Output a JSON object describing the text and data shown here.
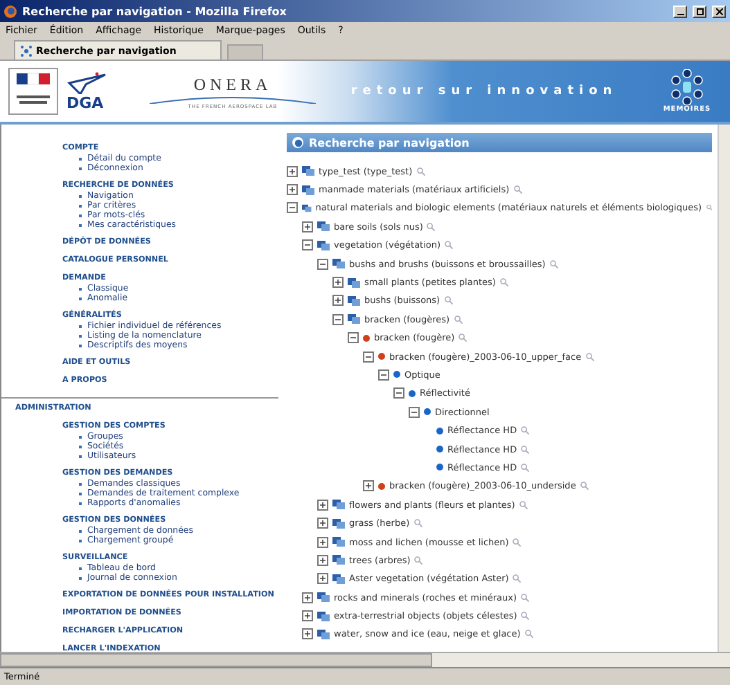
{
  "window": {
    "title": "Recherche par navigation - Mozilla Firefox"
  },
  "menu": [
    "Fichier",
    "Édition",
    "Affichage",
    "Historique",
    "Marque-pages",
    "Outils",
    "?"
  ],
  "tabs": [
    {
      "label": "Recherche par navigation",
      "selected": true
    },
    {
      "selected": false
    }
  ],
  "banner": {
    "dga": "DGA",
    "onera": "ONERA",
    "onera_tagline": "THE FRENCH AEROSPACE LAB",
    "slogan": "retour sur innovation",
    "memoires": "MEMOIRES"
  },
  "sidebar": {
    "sections": [
      {
        "title": "COMPTE",
        "items": [
          "Détail du compte",
          "Déconnexion"
        ]
      },
      {
        "title": "RECHERCHE DE DONNÉES",
        "items": [
          "Navigation",
          "Par critères",
          "Par mots-clés",
          "Mes caractéristiques"
        ]
      },
      {
        "title": "DÉPÔT DE DONNÉES"
      },
      {
        "title": "CATALOGUE PERSONNEL"
      },
      {
        "title": "DEMANDE",
        "items": [
          "Classique",
          "Anomalie"
        ]
      },
      {
        "title": "GÉNÉRALITÉS",
        "items": [
          "Fichier individuel de références",
          "Listing de la nomenclature",
          "Descriptifs des moyens"
        ]
      },
      {
        "title": "AIDE ET OUTILS"
      },
      {
        "title": "A PROPOS"
      }
    ],
    "admin": {
      "title": "ADMINISTRATION",
      "sections": [
        {
          "title": "GESTION DES COMPTES",
          "items": [
            "Groupes",
            "Sociétés",
            "Utilisateurs"
          ]
        },
        {
          "title": "GESTION DES DEMANDES",
          "items": [
            "Demandes classiques",
            "Demandes de traitement complexe",
            "Rapports d'anomalies"
          ]
        },
        {
          "title": "GESTION DES DONNÉES",
          "items": [
            "Chargement de données",
            "Chargement groupé"
          ]
        },
        {
          "title": "SURVEILLANCE",
          "items": [
            "Tableau de bord",
            "Journal de connexion"
          ]
        },
        {
          "title": "EXPORTATION DE DONNÉES POUR INSTALLATION"
        },
        {
          "title": "IMPORTATION DE DONNÉES"
        },
        {
          "title": "RECHARGER L'APPLICATION"
        },
        {
          "title": "LANCER L'INDEXATION"
        }
      ]
    }
  },
  "panel": {
    "title": "Recherche par navigation"
  },
  "tree": [
    {
      "label": "type_test (type_test)",
      "kind": "folder",
      "expanded": false,
      "search": true
    },
    {
      "label": "manmade materials (matériaux artificiels)",
      "kind": "folder",
      "expanded": false,
      "search": true
    },
    {
      "label": "natural materials and biologic elements (matériaux naturels et éléments biologiques)",
      "kind": "folder",
      "expanded": true,
      "search": true,
      "children": [
        {
          "label": "bare soils (sols nus)",
          "kind": "folder",
          "expanded": false,
          "search": true
        },
        {
          "label": "vegetation (végétation)",
          "kind": "folder",
          "expanded": true,
          "search": true,
          "children": [
            {
              "label": "bushs and brushs (buissons et broussailles)",
              "kind": "folder",
              "expanded": true,
              "search": true,
              "children": [
                {
                  "label": "small plants (petites plantes)",
                  "kind": "folder",
                  "expanded": false,
                  "search": true
                },
                {
                  "label": "bushs (buissons)",
                  "kind": "folder",
                  "expanded": false,
                  "search": true
                },
                {
                  "label": "bracken (fougères)",
                  "kind": "folder",
                  "expanded": true,
                  "search": true,
                  "children": [
                    {
                      "label": "bracken (fougère)",
                      "kind": "sample",
                      "expanded": true,
                      "search": true,
                      "children": [
                        {
                          "label": "bracken (fougère)_2003-06-10_upper_face",
                          "kind": "sample",
                          "expanded": true,
                          "search": true,
                          "children": [
                            {
                              "label": "Optique",
                              "kind": "attribute",
                              "expanded": true,
                              "search": false,
                              "children": [
                                {
                                  "label": "Réflectivité",
                                  "kind": "attribute",
                                  "expanded": true,
                                  "search": false,
                                  "children": [
                                    {
                                      "label": "Directionnel",
                                      "kind": "attribute",
                                      "expanded": true,
                                      "search": false,
                                      "children": [
                                        {
                                          "label": "Réflectance HD",
                                          "kind": "attribute",
                                          "search": true
                                        },
                                        {
                                          "label": "Réflectance HD",
                                          "kind": "attribute",
                                          "search": true
                                        },
                                        {
                                          "label": "Réflectance HD",
                                          "kind": "attribute",
                                          "search": true
                                        }
                                      ]
                                    }
                                  ]
                                }
                              ]
                            }
                          ]
                        },
                        {
                          "label": "bracken (fougère)_2003-06-10_underside",
                          "kind": "sample",
                          "expanded": false,
                          "search": true
                        }
                      ]
                    }
                  ]
                }
              ]
            },
            {
              "label": "flowers and plants (fleurs et plantes)",
              "kind": "folder",
              "expanded": false,
              "search": true
            },
            {
              "label": "grass (herbe)",
              "kind": "folder",
              "expanded": false,
              "search": true
            },
            {
              "label": "moss and lichen (mousse et lichen)",
              "kind": "folder",
              "expanded": false,
              "search": true
            },
            {
              "label": "trees (arbres)",
              "kind": "folder",
              "expanded": false,
              "search": true
            },
            {
              "label": "Aster vegetation (végétation Aster)",
              "kind": "folder",
              "expanded": false,
              "search": true
            }
          ]
        },
        {
          "label": "rocks and minerals (roches et minéraux)",
          "kind": "folder",
          "expanded": false,
          "search": true
        },
        {
          "label": "extra-terrestrial objects (objets célestes)",
          "kind": "folder",
          "expanded": false,
          "search": true
        },
        {
          "label": "water, snow and ice (eau, neige et glace)",
          "kind": "folder",
          "expanded": false,
          "search": true
        }
      ]
    }
  ],
  "status_bar": "Terminé"
}
